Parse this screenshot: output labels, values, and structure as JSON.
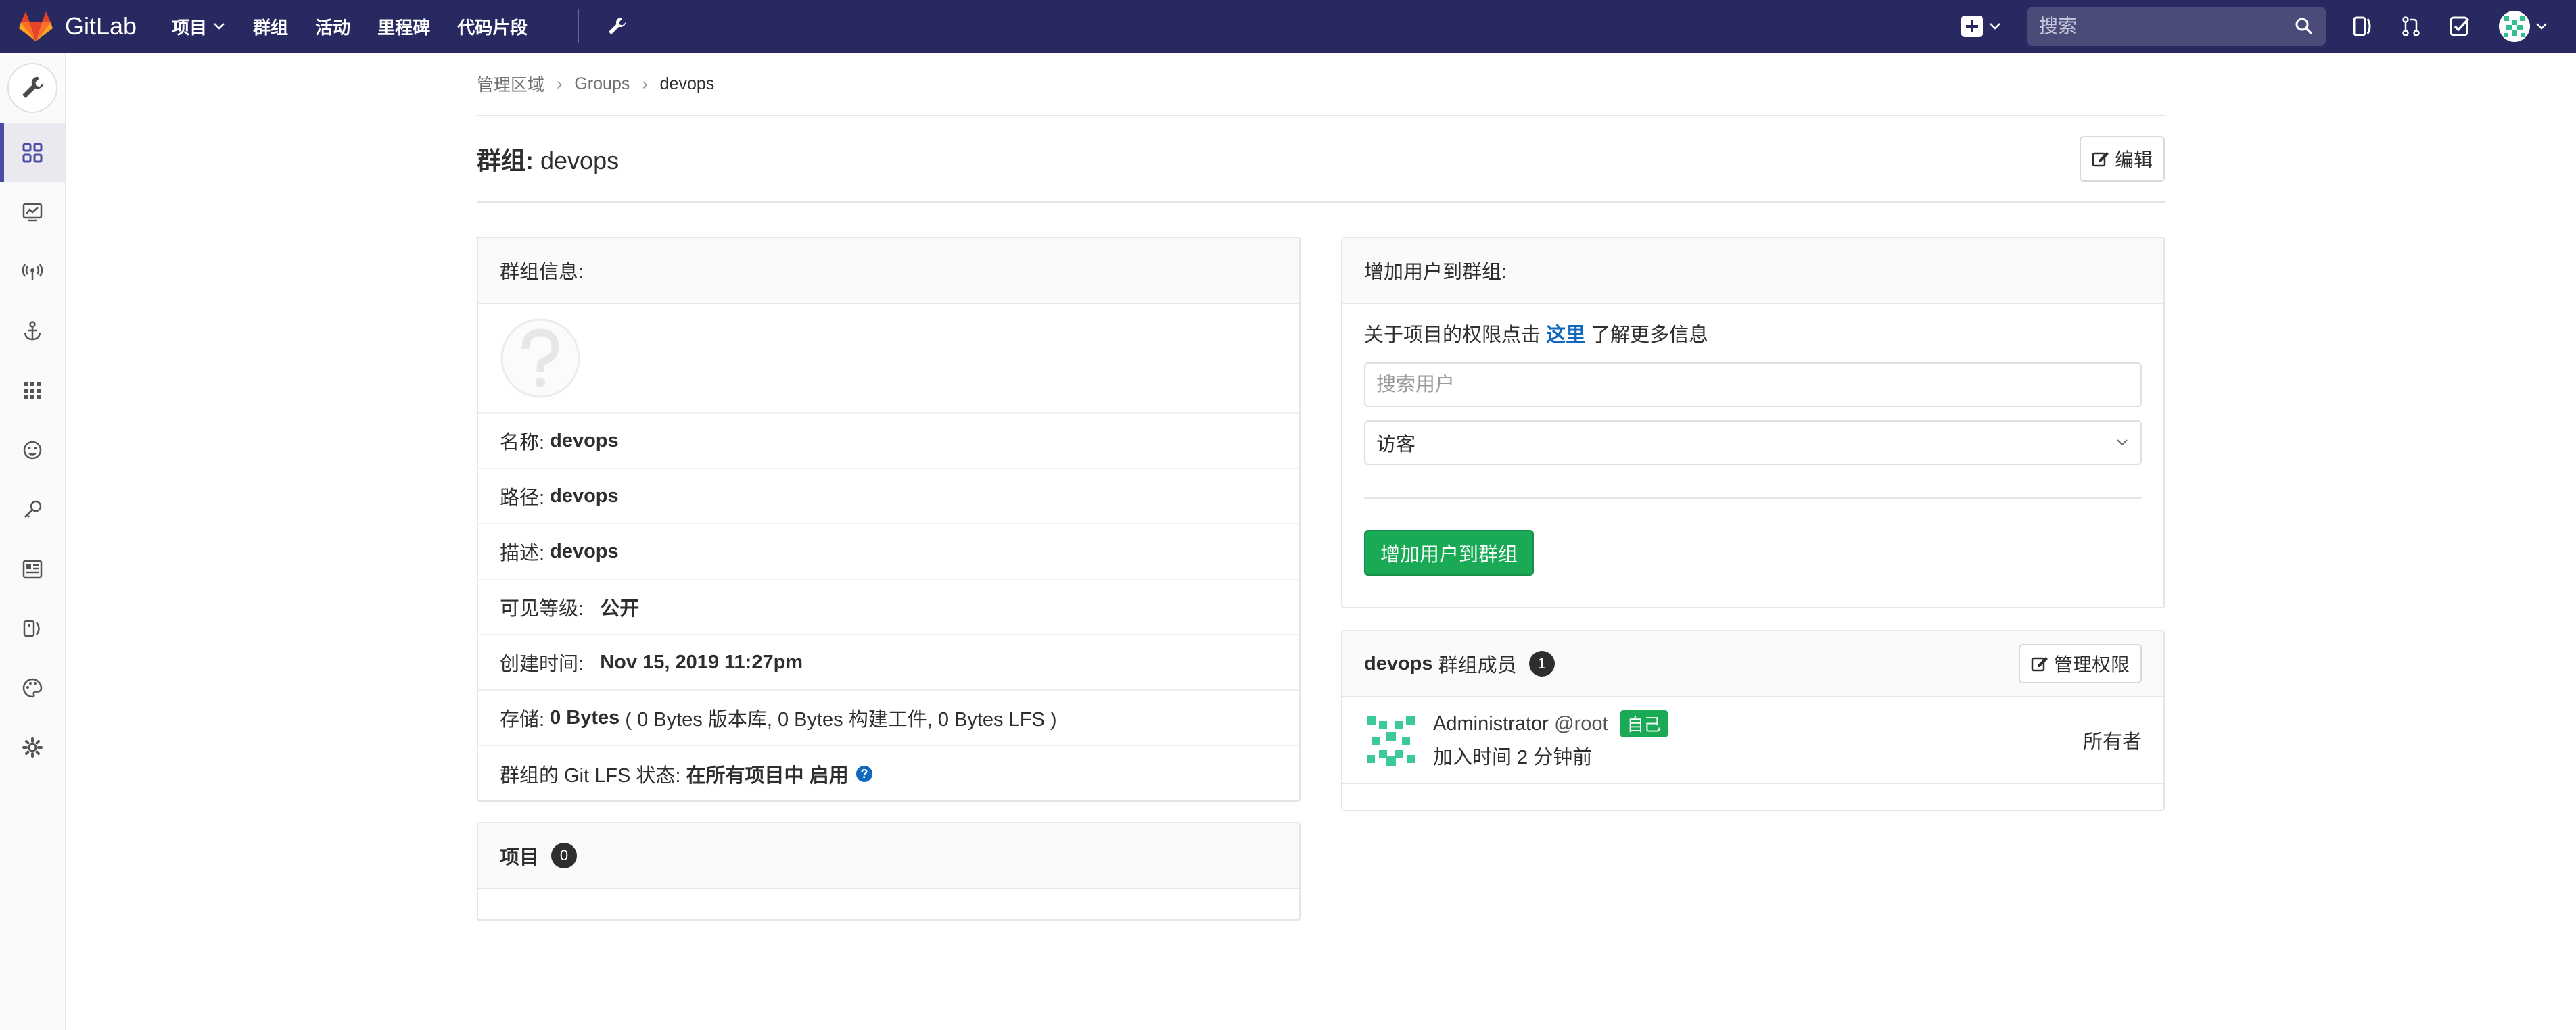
{
  "nav": {
    "brand": "GitLab",
    "links": [
      "项目",
      "群组",
      "活动",
      "里程碑",
      "代码片段"
    ],
    "search_placeholder": "搜索"
  },
  "breadcrumb": {
    "items": [
      "管理区域",
      "Groups"
    ],
    "current": "devops"
  },
  "page": {
    "title_prefix": "群组:",
    "title_name": "devops",
    "edit_label": "编辑"
  },
  "group_info": {
    "heading": "群组信息:",
    "name_label": "名称:",
    "name_value": "devops",
    "path_label": "路径:",
    "path_value": "devops",
    "desc_label": "描述:",
    "desc_value": "devops",
    "visibility_label": "可见等级:",
    "visibility_value": "公开",
    "created_label": "创建时间:",
    "created_value": "Nov 15, 2019 11:27pm",
    "storage_label": "存储:",
    "storage_value": "0 Bytes",
    "storage_detail": "( 0 Bytes 版本库, 0 Bytes 构建工件, 0 Bytes LFS )",
    "lfs_label": "群组的 Git LFS 状态:",
    "lfs_value": "在所有项目中 启用"
  },
  "projects": {
    "heading": "项目",
    "count": "0"
  },
  "add_user": {
    "heading": "增加用户到群组:",
    "hint_before": "关于项目的权限点击",
    "hint_link": "这里",
    "hint_after": "了解更多信息",
    "search_placeholder": "搜索用户",
    "role_selected": "访客",
    "submit_label": "增加用户到群组"
  },
  "members": {
    "group_name": "devops",
    "heading_suffix": "群组成员",
    "count": "1",
    "manage_label": "管理权限",
    "list": [
      {
        "name": "Administrator",
        "username": "@root",
        "self_badge": "自己",
        "joined": "加入时间 2 分钟前",
        "role": "所有者"
      }
    ]
  },
  "colors": {
    "navbar": "#292961",
    "success": "#1aaa55",
    "link": "#1068bf",
    "sidebar_active": "#4b4ba3"
  },
  "icons": {
    "sidebar": [
      "admin-wrench-icon",
      "overview-grid-icon",
      "monitoring-icon",
      "messages-broadcast-icon",
      "system-hooks-anchor-icon",
      "applications-icon",
      "abuse-reports-icon",
      "deploy-keys-key-icon",
      "service-templates-icon",
      "labels-icon",
      "appearance-palette-icon",
      "settings-gear-icon"
    ]
  }
}
